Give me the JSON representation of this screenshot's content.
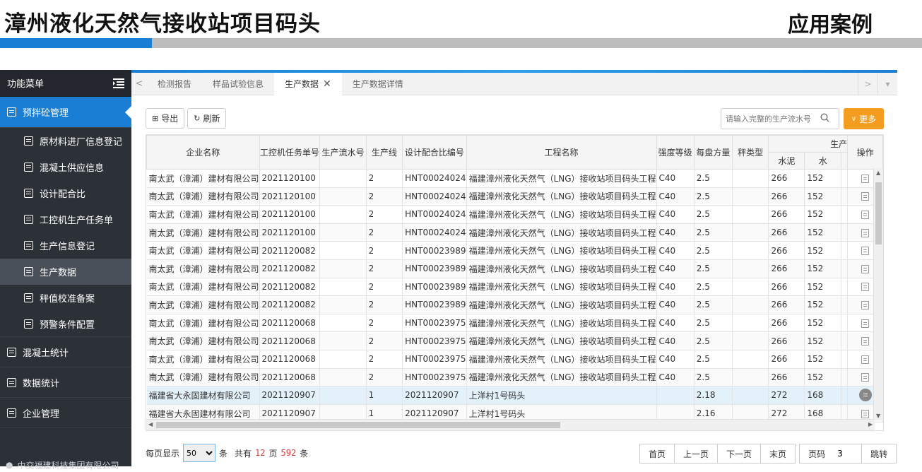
{
  "slide": {
    "title": "漳州液化天然气接收站项目码头",
    "tag": "应用案例"
  },
  "sidebar": {
    "header": "功能菜单",
    "groups": [
      {
        "label": "预拌砼管理"
      },
      {
        "label": "混凝土统计"
      },
      {
        "label": "数据统计"
      },
      {
        "label": "企业管理"
      }
    ],
    "items": [
      {
        "label": "原材料进厂信息登记"
      },
      {
        "label": "混凝土供应信息"
      },
      {
        "label": "设计配合比"
      },
      {
        "label": "工控机生产任务单"
      },
      {
        "label": "生产信息登记"
      },
      {
        "label": "生产数据"
      },
      {
        "label": "秤值校准备案"
      },
      {
        "label": "预警条件配置"
      }
    ],
    "footer": "中交福建科技集团有限公司"
  },
  "tabs": [
    {
      "label": "检测报告"
    },
    {
      "label": "样品试验信息"
    },
    {
      "label": "生产数据"
    },
    {
      "label": "生产数据详情"
    }
  ],
  "toolbar": {
    "export_label": "导出",
    "refresh_label": "刷新",
    "search_placeholder": "请输入完整的生产流水号",
    "more_label": "更多"
  },
  "table": {
    "headers": {
      "company": "企业名称",
      "task_no": "工控机任务单号",
      "serial_no": "生产流水号",
      "line": "生产线",
      "mix_no": "设计配合比编号",
      "project": "工程名称",
      "grade": "强度等级",
      "volume": "每盘方量",
      "scale_type": "秤类型",
      "group": "生产",
      "cement": "水泥",
      "water": "水",
      "op": "操作"
    },
    "rows": [
      [
        "南太武（漳浦）建材有限公司",
        "2021120100",
        "",
        "2",
        "HNT00024024",
        "福建漳州液化天然气（LNG）接收站项目码头工程",
        "C40",
        "2.5",
        "",
        "266",
        "152"
      ],
      [
        "南太武（漳浦）建材有限公司",
        "2021120100",
        "",
        "2",
        "HNT00024024",
        "福建漳州液化天然气（LNG）接收站项目码头工程",
        "C40",
        "2.5",
        "",
        "266",
        "152"
      ],
      [
        "南太武（漳浦）建材有限公司",
        "2021120100",
        "",
        "2",
        "HNT00024024",
        "福建漳州液化天然气（LNG）接收站项目码头工程",
        "C40",
        "2.5",
        "",
        "266",
        "152"
      ],
      [
        "南太武（漳浦）建材有限公司",
        "2021120100",
        "",
        "2",
        "HNT00024024",
        "福建漳州液化天然气（LNG）接收站项目码头工程",
        "C40",
        "2.5",
        "",
        "266",
        "152"
      ],
      [
        "南太武（漳浦）建材有限公司",
        "2021120082",
        "",
        "2",
        "HNT00023989",
        "福建漳州液化天然气（LNG）接收站项目码头工程",
        "C40",
        "2.5",
        "",
        "266",
        "152"
      ],
      [
        "南太武（漳浦）建材有限公司",
        "2021120082",
        "",
        "2",
        "HNT00023989",
        "福建漳州液化天然气（LNG）接收站项目码头工程",
        "C40",
        "2.5",
        "",
        "266",
        "152"
      ],
      [
        "南太武（漳浦）建材有限公司",
        "2021120082",
        "",
        "2",
        "HNT00023989",
        "福建漳州液化天然气（LNG）接收站项目码头工程",
        "C40",
        "2.5",
        "",
        "266",
        "152"
      ],
      [
        "南太武（漳浦）建材有限公司",
        "2021120082",
        "",
        "2",
        "HNT00023989",
        "福建漳州液化天然气（LNG）接收站项目码头工程",
        "C40",
        "2.5",
        "",
        "266",
        "152"
      ],
      [
        "南太武（漳浦）建材有限公司",
        "2021120068",
        "",
        "2",
        "HNT00023975",
        "福建漳州液化天然气（LNG）接收站项目码头工程",
        "C40",
        "2.5",
        "",
        "266",
        "152"
      ],
      [
        "南太武（漳浦）建材有限公司",
        "2021120068",
        "",
        "2",
        "HNT00023975",
        "福建漳州液化天然气（LNG）接收站项目码头工程",
        "C40",
        "2.5",
        "",
        "266",
        "152"
      ],
      [
        "南太武（漳浦）建材有限公司",
        "2021120068",
        "",
        "2",
        "HNT00023975",
        "福建漳州液化天然气（LNG）接收站项目码头工程",
        "C40",
        "2.5",
        "",
        "266",
        "152"
      ],
      [
        "南太武（漳浦）建材有限公司",
        "2021120068",
        "",
        "2",
        "HNT00023975",
        "福建漳州液化天然气（LNG）接收站项目码头工程",
        "C40",
        "2.5",
        "",
        "266",
        "152"
      ],
      [
        "福建省大永固建材有限公司",
        "2021120907",
        "",
        "1",
        "2021120907",
        "上洋村1号码头",
        "",
        "2.18",
        "",
        "272",
        "168"
      ],
      [
        "福建省大永固建材有限公司",
        "2021120907",
        "",
        "1",
        "2021120907",
        "上洋村1号码头",
        "",
        "2.16",
        "",
        "272",
        "168"
      ]
    ]
  },
  "pager": {
    "per_page_label": "每页显示",
    "per_page_value": "50",
    "unit_label": "条",
    "total_prefix": "共有",
    "total_pages": "12",
    "pages_unit": "页",
    "total_records": "592",
    "records_unit": "条",
    "first": "首页",
    "prev": "上一页",
    "next": "下一页",
    "last": "末页",
    "page_label": "页码",
    "page_value": "3",
    "jump": "跳转"
  },
  "colors": {
    "accent": "#1a7fd4",
    "sidebar_bg": "#2c3138",
    "more_button": "#f39c1f",
    "count_red": "#e03a3a"
  }
}
